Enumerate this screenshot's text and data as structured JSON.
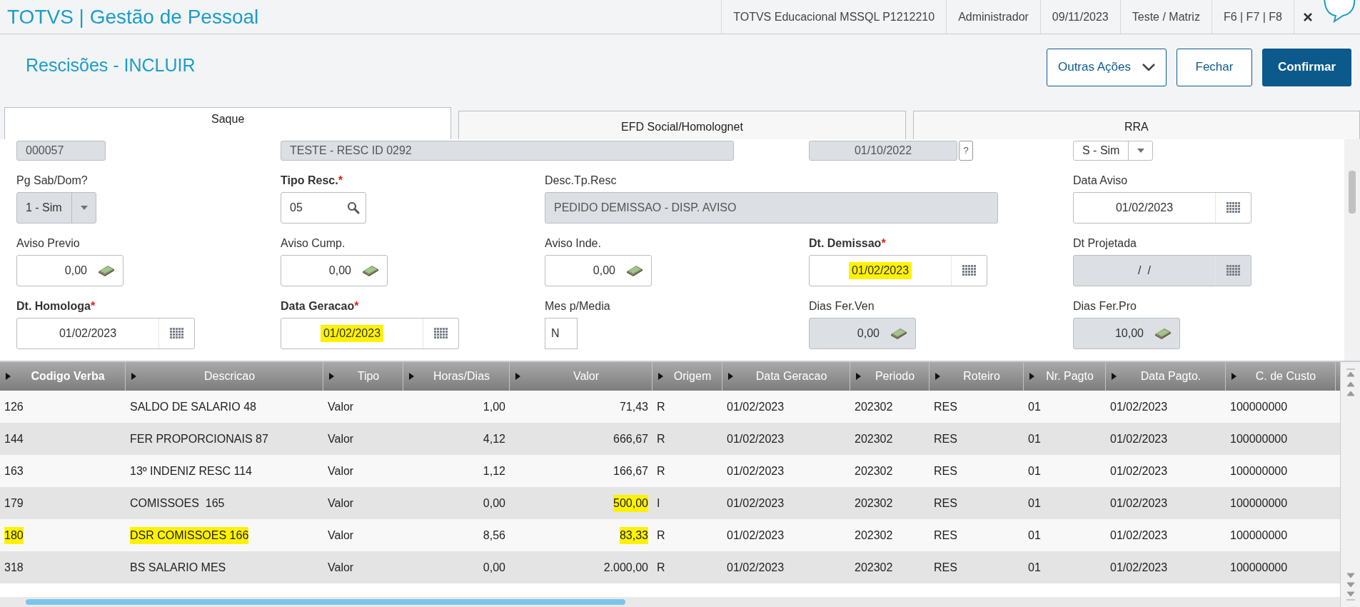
{
  "app": {
    "title": "TOTVS | Gestão de Pessoal",
    "info": [
      "TOTVS Educacional MSSQL P1212210",
      "Administrador",
      "09/11/2023",
      "Teste / Matriz",
      "F6 | F7 | F8"
    ]
  },
  "page": {
    "title": "Rescisões - INCLUIR",
    "buttons": [
      {
        "label": "Outras Ações",
        "kind": "menu"
      },
      {
        "label": "Fechar",
        "kind": "secondary"
      },
      {
        "label": "Confirmar",
        "kind": "primary"
      }
    ]
  },
  "tabs": [
    {
      "label": "Saque",
      "selected": true
    },
    {
      "label": "EFD Social/Homolognet",
      "selected": false
    },
    {
      "label": "RRA",
      "selected": false
    }
  ],
  "form_rows": [
    [
      {
        "kind": "text",
        "value": "000057",
        "disabled": true,
        "highlighted": false
      },
      {
        "kind": "wide",
        "value": "TESTE - RESC ID 0292",
        "disabled": true,
        "highlighted": false
      },
      {
        "kind": "help",
        "value": "01/10/2022",
        "button": "?",
        "disabled": true,
        "highlighted": false
      },
      {
        "kind": "select",
        "value": "S - Sim",
        "disabled": false,
        "highlighted": false
      }
    ],
    [
      {
        "kind": "select",
        "label": "Pg Sab/Dom?",
        "required": false,
        "value": "1 - Sim",
        "disabled": true,
        "highlighted": false
      },
      {
        "kind": "lookup",
        "label": "Tipo Resc.",
        "required": true,
        "value": "05",
        "disabled": false,
        "highlighted": false
      },
      {
        "kind": "wide",
        "label": "Desc.Tp.Resc",
        "required": false,
        "value": "PEDIDO DEMISSAO - DISP. AVISO",
        "disabled": true,
        "highlighted": false
      },
      {
        "kind": "date",
        "label": "Data Aviso",
        "required": false,
        "value": "01/02/2023",
        "disabled": false,
        "highlighted": false
      }
    ],
    [
      {
        "kind": "money",
        "label": "Aviso Previo",
        "required": false,
        "value": "0,00",
        "disabled": false,
        "highlighted": false
      },
      {
        "kind": "money",
        "label": "Aviso Cump.",
        "required": false,
        "value": "0,00",
        "disabled": false,
        "highlighted": false
      },
      {
        "kind": "money",
        "label": "Aviso Inde.",
        "required": false,
        "value": "0,00",
        "disabled": false,
        "highlighted": false
      },
      {
        "kind": "date",
        "label": "Dt. Demissao",
        "required": true,
        "value": "01/02/2023",
        "disabled": false,
        "highlighted": true
      },
      {
        "kind": "date",
        "label": "Dt Projetada",
        "required": false,
        "value": "/  /",
        "disabled": true,
        "highlighted": false
      }
    ],
    [
      {
        "kind": "date",
        "label": "Dt. Homologa",
        "required": true,
        "value": "01/02/2023",
        "disabled": false,
        "highlighted": false
      },
      {
        "kind": "date",
        "label": "Data Geracao",
        "required": true,
        "value": "01/02/2023",
        "disabled": false,
        "highlighted": true
      },
      {
        "kind": "char",
        "label": "Mes p/Media",
        "required": false,
        "value": "N",
        "disabled": false,
        "highlighted": false
      },
      {
        "kind": "money",
        "label": "Dias Fer.Ven",
        "required": false,
        "value": "0,00",
        "disabled": true,
        "highlighted": false
      },
      {
        "kind": "money",
        "label": "Dias Fer.Pro",
        "required": false,
        "value": "10,00",
        "disabled": true,
        "highlighted": false
      }
    ]
  ],
  "required_marker": "*",
  "table": {
    "columns": [
      {
        "label": "Codigo Verba",
        "bold": true
      },
      {
        "label": "Descricao",
        "bold": false
      },
      {
        "label": "Tipo",
        "bold": false
      },
      {
        "label": "Horas/Dias",
        "bold": false
      },
      {
        "label": "Valor",
        "bold": false
      },
      {
        "label": "Origem",
        "bold": false
      },
      {
        "label": "Data Geracao",
        "bold": false
      },
      {
        "label": "Periodo",
        "bold": false
      },
      {
        "label": "Roteiro",
        "bold": false
      },
      {
        "label": "Nr. Pagto",
        "bold": false
      },
      {
        "label": "Data Pagto.",
        "bold": false
      },
      {
        "label": "C. de Custo",
        "bold": false
      }
    ],
    "rows": [
      {
        "cells": [
          {
            "text": "126",
            "highlighted": false
          },
          {
            "text": "SALDO DE SALARIO 48",
            "highlighted": false
          },
          {
            "text": "Valor",
            "highlighted": false
          },
          {
            "text": "1,00",
            "highlighted": false
          },
          {
            "text": "71,43",
            "highlighted": false
          },
          {
            "text": "R",
            "highlighted": false
          },
          {
            "text": "01/02/2023",
            "highlighted": false
          },
          {
            "text": "202302",
            "highlighted": false
          },
          {
            "text": "RES",
            "highlighted": false
          },
          {
            "text": "01",
            "highlighted": false
          },
          {
            "text": "01/02/2023",
            "highlighted": false
          },
          {
            "text": "100000000",
            "highlighted": false
          }
        ]
      },
      {
        "cells": [
          {
            "text": "144",
            "highlighted": false
          },
          {
            "text": "FER PROPORCIONAIS 87",
            "highlighted": false
          },
          {
            "text": "Valor",
            "highlighted": false
          },
          {
            "text": "4,12",
            "highlighted": false
          },
          {
            "text": "666,67",
            "highlighted": false
          },
          {
            "text": "R",
            "highlighted": false
          },
          {
            "text": "01/02/2023",
            "highlighted": false
          },
          {
            "text": "202302",
            "highlighted": false
          },
          {
            "text": "RES",
            "highlighted": false
          },
          {
            "text": "01",
            "highlighted": false
          },
          {
            "text": "01/02/2023",
            "highlighted": false
          },
          {
            "text": "100000000",
            "highlighted": false
          }
        ]
      },
      {
        "cells": [
          {
            "text": "163",
            "highlighted": false
          },
          {
            "text": "13º INDENIZ RESC 114",
            "highlighted": false
          },
          {
            "text": "Valor",
            "highlighted": false
          },
          {
            "text": "1,12",
            "highlighted": false
          },
          {
            "text": "166,67",
            "highlighted": false
          },
          {
            "text": "R",
            "highlighted": false
          },
          {
            "text": "01/02/2023",
            "highlighted": false
          },
          {
            "text": "202302",
            "highlighted": false
          },
          {
            "text": "RES",
            "highlighted": false
          },
          {
            "text": "01",
            "highlighted": false
          },
          {
            "text": "01/02/2023",
            "highlighted": false
          },
          {
            "text": "100000000",
            "highlighted": false
          }
        ]
      },
      {
        "cells": [
          {
            "text": "179",
            "highlighted": false
          },
          {
            "text": "COMISSOES  165",
            "highlighted": false
          },
          {
            "text": "Valor",
            "highlighted": false
          },
          {
            "text": "0,00",
            "highlighted": false
          },
          {
            "text": "500,00",
            "highlighted": true
          },
          {
            "text": "I",
            "highlighted": false
          },
          {
            "text": "01/02/2023",
            "highlighted": false
          },
          {
            "text": "202302",
            "highlighted": false
          },
          {
            "text": "RES",
            "highlighted": false
          },
          {
            "text": "01",
            "highlighted": false
          },
          {
            "text": "01/02/2023",
            "highlighted": false
          },
          {
            "text": "100000000",
            "highlighted": false
          }
        ]
      },
      {
        "cells": [
          {
            "text": "180",
            "highlighted": true
          },
          {
            "text": "DSR COMISSOES 166",
            "highlighted": true
          },
          {
            "text": "Valor",
            "highlighted": false
          },
          {
            "text": "8,56",
            "highlighted": false
          },
          {
            "text": "83,33",
            "highlighted": true
          },
          {
            "text": "R",
            "highlighted": false
          },
          {
            "text": "01/02/2023",
            "highlighted": false
          },
          {
            "text": "202302",
            "highlighted": false
          },
          {
            "text": "RES",
            "highlighted": false
          },
          {
            "text": "01",
            "highlighted": false
          },
          {
            "text": "01/02/2023",
            "highlighted": false
          },
          {
            "text": "100000000",
            "highlighted": false
          }
        ]
      },
      {
        "cells": [
          {
            "text": "318",
            "highlighted": false
          },
          {
            "text": "BS SALARIO MES",
            "highlighted": false
          },
          {
            "text": "Valor",
            "highlighted": false
          },
          {
            "text": "0,00",
            "highlighted": false
          },
          {
            "text": "2.000,00",
            "highlighted": false
          },
          {
            "text": "R",
            "highlighted": false
          },
          {
            "text": "01/02/2023",
            "highlighted": false
          },
          {
            "text": "202302",
            "highlighted": false
          },
          {
            "text": "RES",
            "highlighted": false
          },
          {
            "text": "01",
            "highlighted": false
          },
          {
            "text": "01/02/2023",
            "highlighted": false
          },
          {
            "text": "100000000",
            "highlighted": false
          }
        ]
      }
    ]
  }
}
